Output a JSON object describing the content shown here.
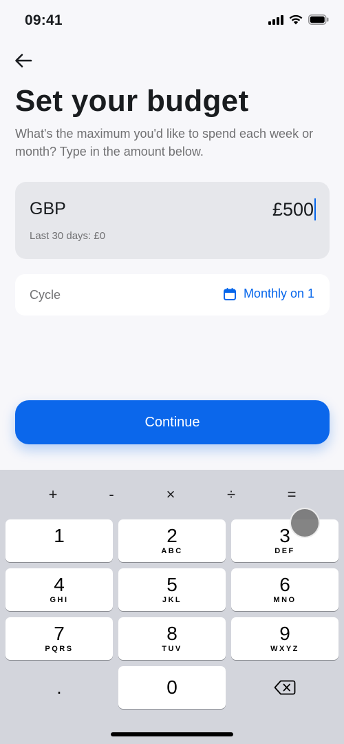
{
  "status_bar": {
    "time": "09:41"
  },
  "header": {
    "title": "Set your budget",
    "subtitle": "What's the maximum you'd like to spend each week or month? Type in the amount below."
  },
  "amount": {
    "currency": "GBP",
    "value": "£500",
    "last_30_days": "Last 30 days: £0"
  },
  "cycle": {
    "label": "Cycle",
    "value": "Monthly on 1"
  },
  "continue_label": "Continue",
  "keyboard": {
    "operators": [
      "+",
      "-",
      "×",
      "÷",
      "="
    ],
    "keys": [
      {
        "digit": "1",
        "letters": ""
      },
      {
        "digit": "2",
        "letters": "ABC"
      },
      {
        "digit": "3",
        "letters": "DEF"
      },
      {
        "digit": "4",
        "letters": "GHI"
      },
      {
        "digit": "5",
        "letters": "JKL"
      },
      {
        "digit": "6",
        "letters": "MNO"
      },
      {
        "digit": "7",
        "letters": "PQRS"
      },
      {
        "digit": "8",
        "letters": "TUV"
      },
      {
        "digit": "9",
        "letters": "WXYZ"
      },
      {
        "digit": "0",
        "letters": ""
      }
    ],
    "decimal": "."
  },
  "colors": {
    "accent": "#0b67eb",
    "link": "#0666eb",
    "background": "#f7f7fa",
    "keyboard": "#d3d5dc"
  }
}
